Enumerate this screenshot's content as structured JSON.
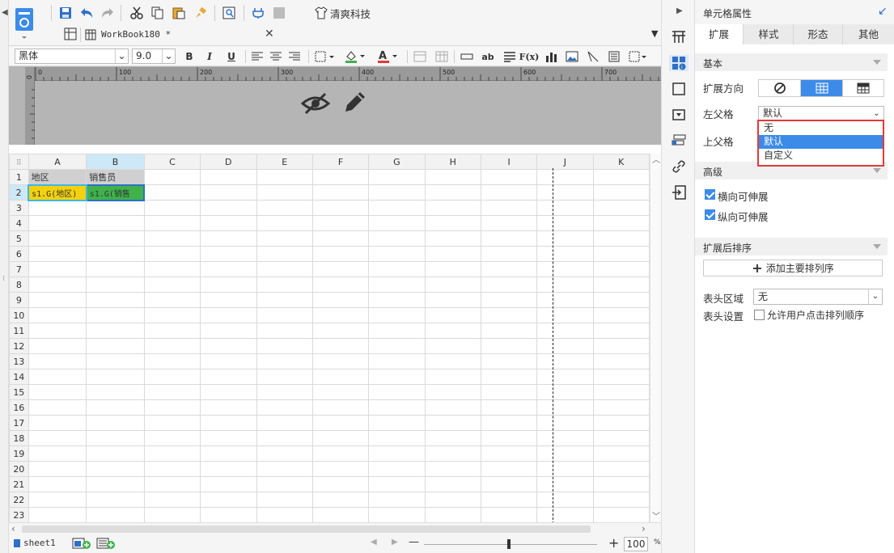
{
  "toolbar": {
    "theme_label": "清爽科技"
  },
  "document_tab": {
    "title": "WorkBook180 *"
  },
  "format_bar": {
    "font_family": "黑体",
    "font_size": "9.0",
    "bold": "B",
    "italic": "I",
    "underline": "U",
    "text_ab": "ab",
    "fx": "F(x)"
  },
  "sheet": {
    "columns": [
      "A",
      "B",
      "C",
      "D",
      "E",
      "F",
      "G",
      "H",
      "I",
      "J",
      "K"
    ],
    "row_count": 23,
    "cells": {
      "A1": "地区",
      "B1": "销售员",
      "A2": "s1.G(地区)",
      "B2": "s1.G(销售"
    }
  },
  "sheet_tabs": {
    "sheet1": "sheet1"
  },
  "zoom": {
    "minus": "—",
    "plus": "+",
    "value": "100",
    "unit": "%"
  },
  "ruler": {
    "labels": [
      "0",
      "100",
      "200",
      "300",
      "400",
      "500",
      "600",
      "700"
    ]
  },
  "panel": {
    "title": "单元格属性",
    "tabs": [
      "扩展",
      "样式",
      "形态",
      "其他"
    ],
    "active_tab": "扩展",
    "basic": {
      "header": "基本",
      "expand_direction_label": "扩展方向",
      "left_parent_label": "左父格",
      "left_parent_value": "默认",
      "top_parent_label": "上父格",
      "dropdown_options": [
        "无",
        "默认",
        "自定义"
      ],
      "dropdown_selected": "默认"
    },
    "advanced": {
      "header": "高级",
      "horizontal_extend": "横向可伸展",
      "vertical_extend": "纵向可伸展",
      "horizontal_checked": true,
      "vertical_checked": true
    },
    "sort": {
      "header": "扩展后排序",
      "add_button": "添加主要排列序"
    },
    "table_head": {
      "area_label": "表头区域",
      "area_value": "无",
      "settings_label": "表头设置",
      "allow_sort": "允许用户点击排列顺序",
      "allow_sort_checked": false
    }
  },
  "colors": {
    "accent": "#3c8be8",
    "highlight_red": "#e23a3a",
    "cell_a2": "#f4d10c",
    "cell_b2": "#3fb24c"
  }
}
